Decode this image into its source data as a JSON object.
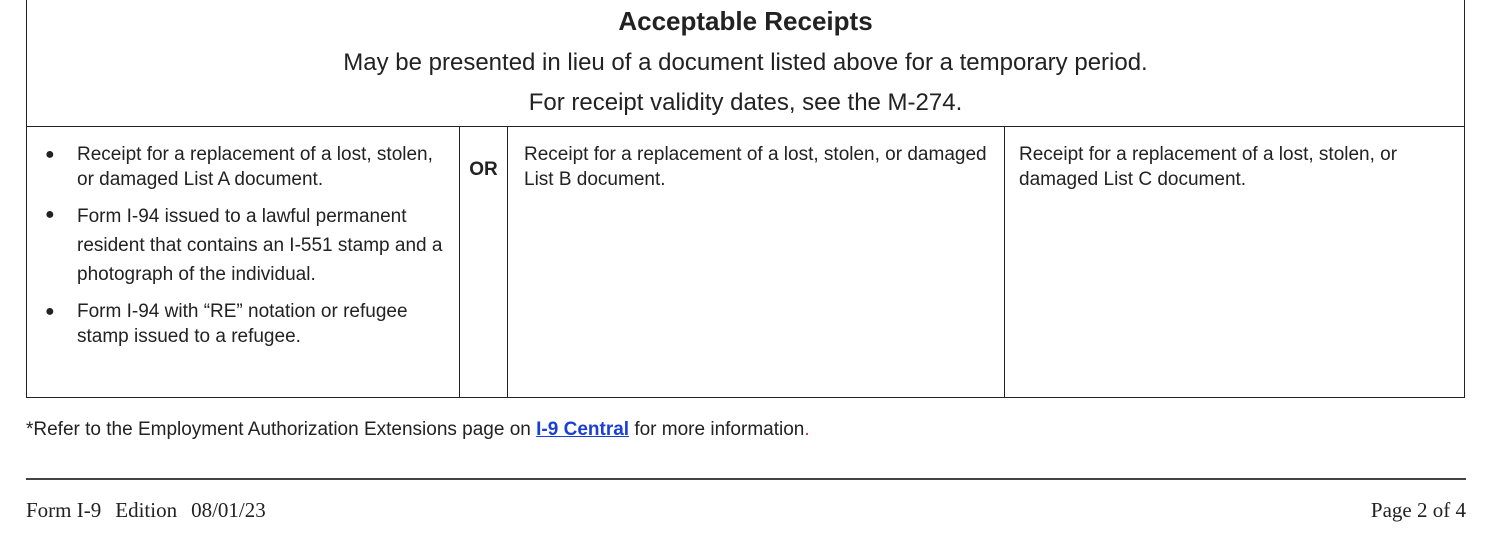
{
  "header": {
    "title": "Acceptable Receipts",
    "subtitle": "May be presented in lieu of a document listed above for a temporary period.",
    "note": "For receipt validity dates, see the M-274."
  },
  "list_a": {
    "items": [
      "Receipt for a replacement of a lost, stolen, or damaged List A document.",
      "Form I-94 issued to a lawful permanent resident that contains an I-551 stamp and a photograph of the individual.",
      "Form I-94 with “RE” notation or refugee stamp issued to a refugee."
    ]
  },
  "or_label": "OR",
  "list_b": {
    "text": "Receipt for a replacement of a lost, stolen, or damaged List B document."
  },
  "list_c": {
    "text": "Receipt for a replacement of a lost, stolen, or damaged List C document."
  },
  "footnote": {
    "before": "*Refer to the Employment Authorization Extensions page on ",
    "link": "I-9 Central",
    "after": " for more information",
    "end": "."
  },
  "footer": {
    "form": "Form I-9",
    "edition_label": "Edition",
    "edition_date": "08/01/23",
    "page": "Page 2 of 4"
  },
  "colors": {
    "link": "#1a3fd6",
    "accent_dot": "#c0392b",
    "text": "#222222"
  }
}
